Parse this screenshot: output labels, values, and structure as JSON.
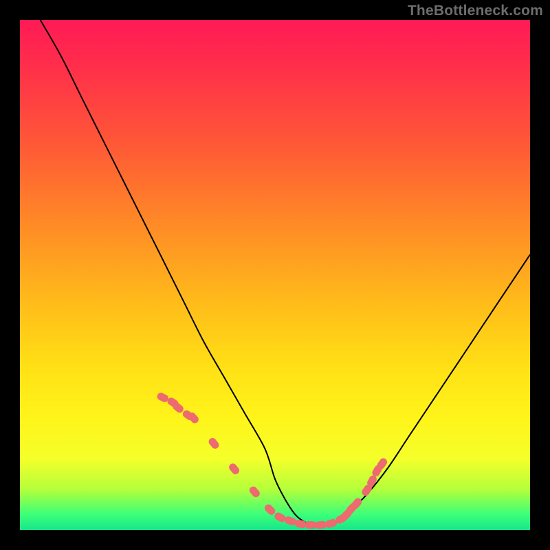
{
  "watermark": "TheBottleneck.com",
  "chart_data": {
    "type": "line",
    "title": "",
    "xlabel": "",
    "ylabel": "",
    "xlim": [
      0,
      100
    ],
    "ylim": [
      0,
      100
    ],
    "grid": false,
    "legend": false,
    "series": [
      {
        "name": "bottleneck-curve",
        "color": "#000000",
        "x": [
          4,
          8,
          12,
          16,
          20,
          24,
          28,
          32,
          36,
          40,
          44,
          48,
          50,
          52,
          54,
          56,
          58,
          60,
          62,
          64,
          68,
          72,
          76,
          80,
          84,
          88,
          92,
          96,
          100
        ],
        "y": [
          100,
          93,
          85,
          77,
          69,
          61,
          53,
          45,
          37,
          30,
          23,
          16,
          10,
          6,
          3,
          1.5,
          1,
          1,
          1.5,
          3,
          7,
          12,
          18,
          24,
          30,
          36,
          42,
          48,
          54
        ]
      },
      {
        "name": "highlight-dots",
        "color": "#ed6a6f",
        "type": "scatter",
        "x": [
          28,
          30,
          31,
          33,
          34,
          38,
          42,
          46,
          49,
          51,
          53,
          55,
          57,
          59,
          61,
          63,
          64,
          65,
          66,
          68,
          69,
          70,
          71
        ],
        "y": [
          26,
          25,
          24,
          22.5,
          22,
          17,
          12,
          7.5,
          4,
          2.5,
          1.8,
          1.2,
          1,
          1,
          1.3,
          2.2,
          3.0,
          4.2,
          5.2,
          7.8,
          9.6,
          11.6,
          13.0
        ]
      }
    ],
    "background_gradient": {
      "top": "#ff1a56",
      "upper_mid": "#ff8a26",
      "mid": "#ffe015",
      "lower_mid": "#f5ff2a",
      "bottom": "#17e58b"
    }
  }
}
